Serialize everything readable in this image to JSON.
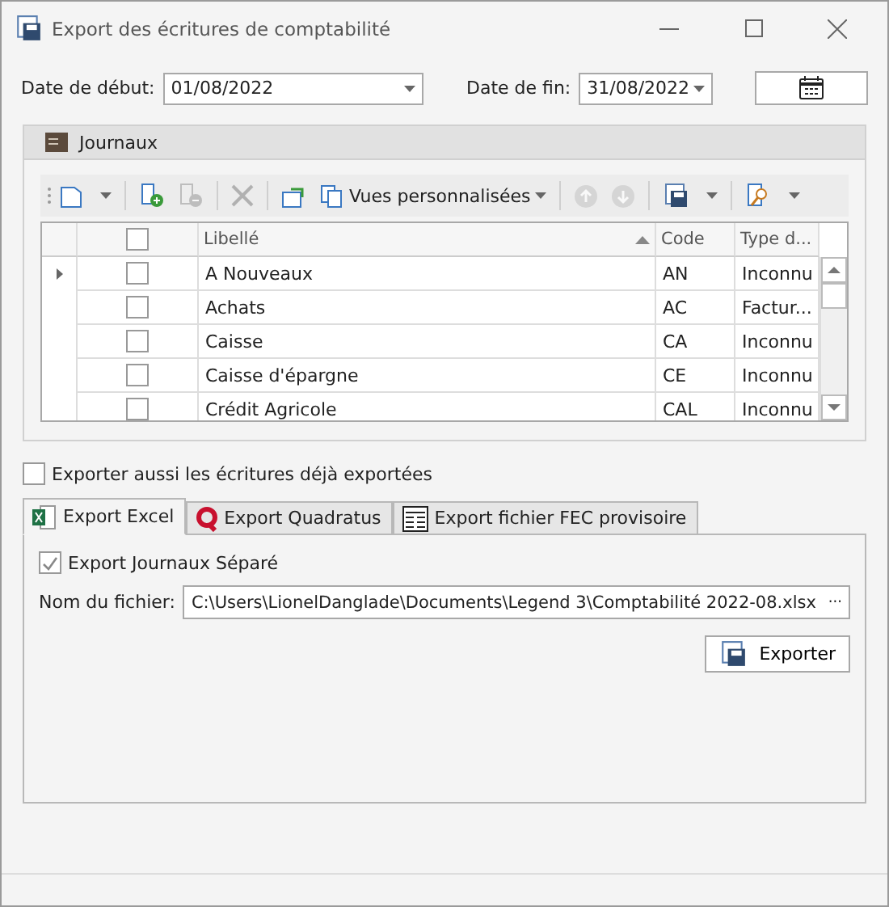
{
  "window": {
    "title": "Export des écritures de comptabilité"
  },
  "dates": [
    {
      "label": "Date de début:",
      "value": "01/08/2022"
    },
    {
      "label": "Date de fin:",
      "value": "31/08/2022"
    }
  ],
  "journaux": {
    "title": "Journaux",
    "toolbar": [
      {
        "kind": "new",
        "disabled": false,
        "dropdown": true
      },
      {
        "kind": "sep"
      },
      {
        "kind": "add",
        "disabled": false
      },
      {
        "kind": "remove",
        "disabled": true
      },
      {
        "kind": "sep"
      },
      {
        "kind": "delete",
        "disabled": true
      },
      {
        "kind": "sep"
      },
      {
        "kind": "refresh",
        "disabled": false
      },
      {
        "kind": "views",
        "disabled": false,
        "label": "Vues personnalisées",
        "dropdown": true
      },
      {
        "kind": "sep"
      },
      {
        "kind": "up",
        "disabled": true
      },
      {
        "kind": "down",
        "disabled": true
      },
      {
        "kind": "sep"
      },
      {
        "kind": "save",
        "disabled": false,
        "dropdown": true
      },
      {
        "kind": "sep"
      },
      {
        "kind": "search",
        "disabled": false,
        "dropdown": true
      }
    ],
    "columns": [
      {
        "label": "Libellé",
        "sorted": true
      },
      {
        "label": "Code"
      },
      {
        "label": "Type d..."
      }
    ],
    "header_checked": false,
    "rows": [
      {
        "current": true,
        "checked": false,
        "cells": [
          "A Nouveaux",
          "AN",
          "Inconnu"
        ]
      },
      {
        "current": false,
        "checked": false,
        "cells": [
          "Achats",
          "AC",
          "Factur..."
        ]
      },
      {
        "current": false,
        "checked": false,
        "cells": [
          "Caisse",
          "CA",
          "Inconnu"
        ]
      },
      {
        "current": false,
        "checked": false,
        "cells": [
          "Caisse d'épargne",
          "CE",
          "Inconnu"
        ]
      },
      {
        "current": false,
        "checked": false,
        "cells": [
          "Crédit Agricole",
          "CAL",
          "Inconnu"
        ]
      }
    ]
  },
  "export_again": {
    "label": "Exporter aussi les écritures déjà exportées",
    "checked": false
  },
  "tabs": [
    {
      "kind": "excel",
      "label": "Export Excel",
      "selected": true
    },
    {
      "kind": "quadratus",
      "label": "Export Quadratus",
      "selected": false
    },
    {
      "kind": "fec",
      "label": "Export fichier FEC provisoire",
      "selected": false
    }
  ],
  "excel": {
    "separate": {
      "label": "Export Journaux Séparé",
      "checked": true
    },
    "file_label": "Nom du fichier:",
    "file_value": "C:\\Users\\LionelDanglade\\Documents\\Legend 3\\Comptabilité 2022-08.xlsx",
    "browse": "···",
    "export_button": "Exporter"
  }
}
